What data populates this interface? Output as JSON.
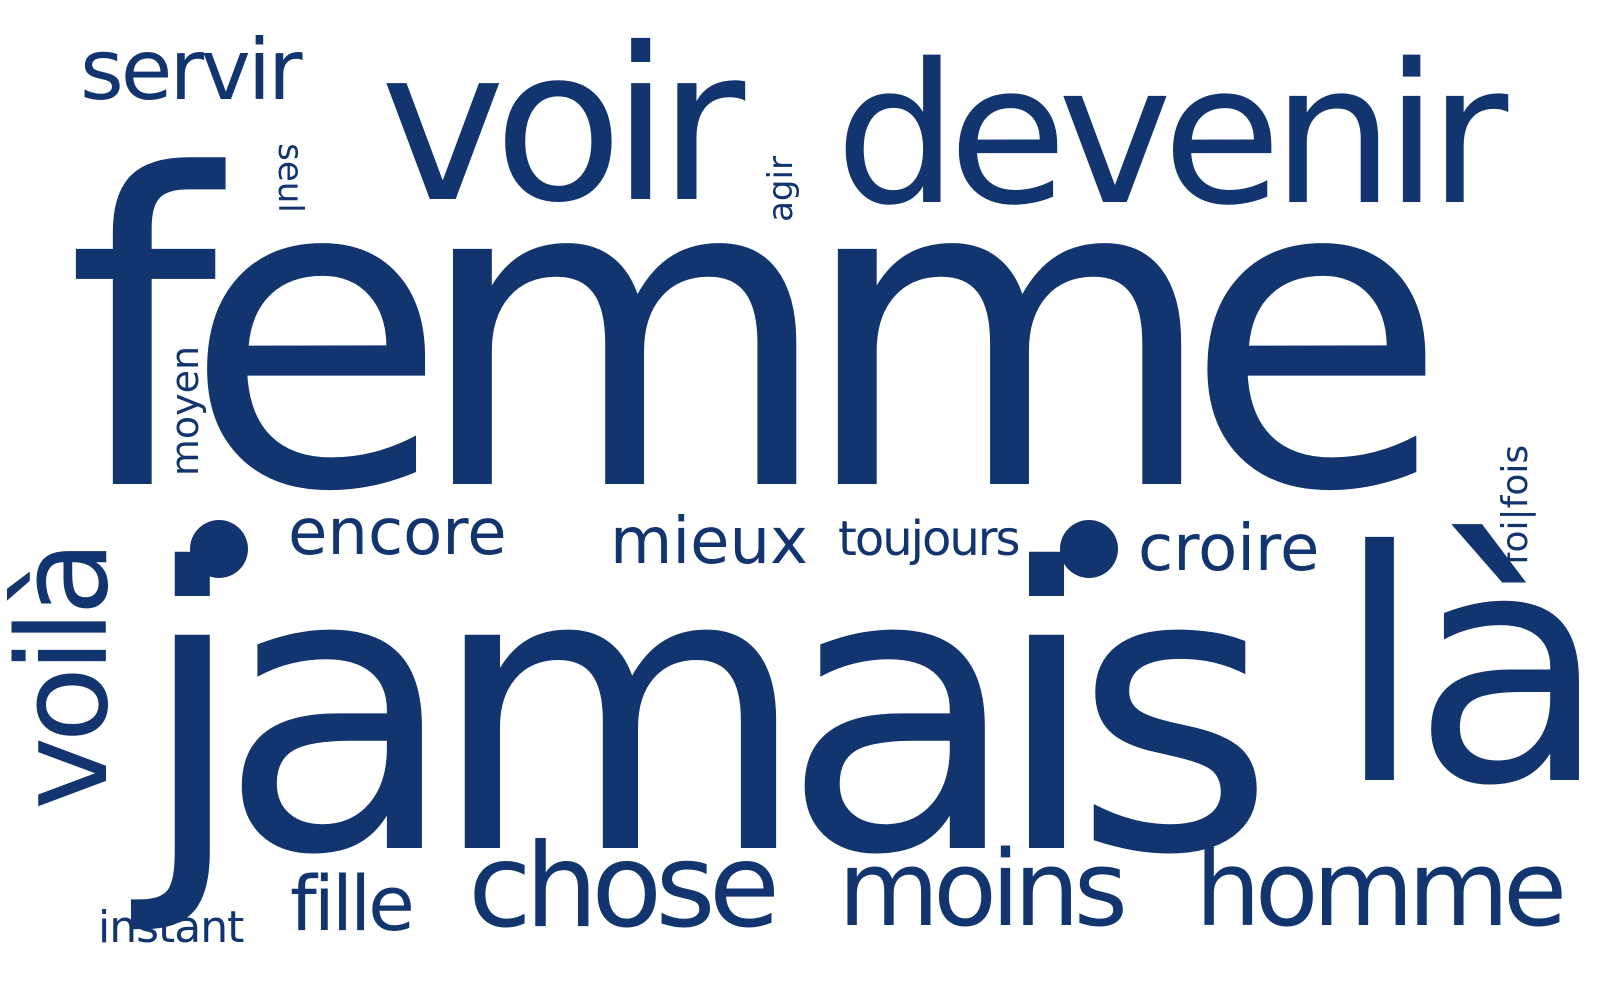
{
  "cloud": {
    "color": "#12356f",
    "background": "#ffffff",
    "words": {
      "femme": "femme",
      "jamais": "jamais",
      "la": "là",
      "voir": "voir",
      "devenir": "devenir",
      "servir": "servir",
      "voila": "voilà",
      "chose": "chose",
      "moins": "moins",
      "homme": "homme",
      "fille": "fille",
      "instant": "instant",
      "encore": "encore",
      "mieux": "mieux",
      "toujours": "toujours",
      "croire": "croire",
      "moyen": "moyen",
      "seul": "seul",
      "agir": "agir",
      "foisfois": "foi|fois"
    }
  }
}
